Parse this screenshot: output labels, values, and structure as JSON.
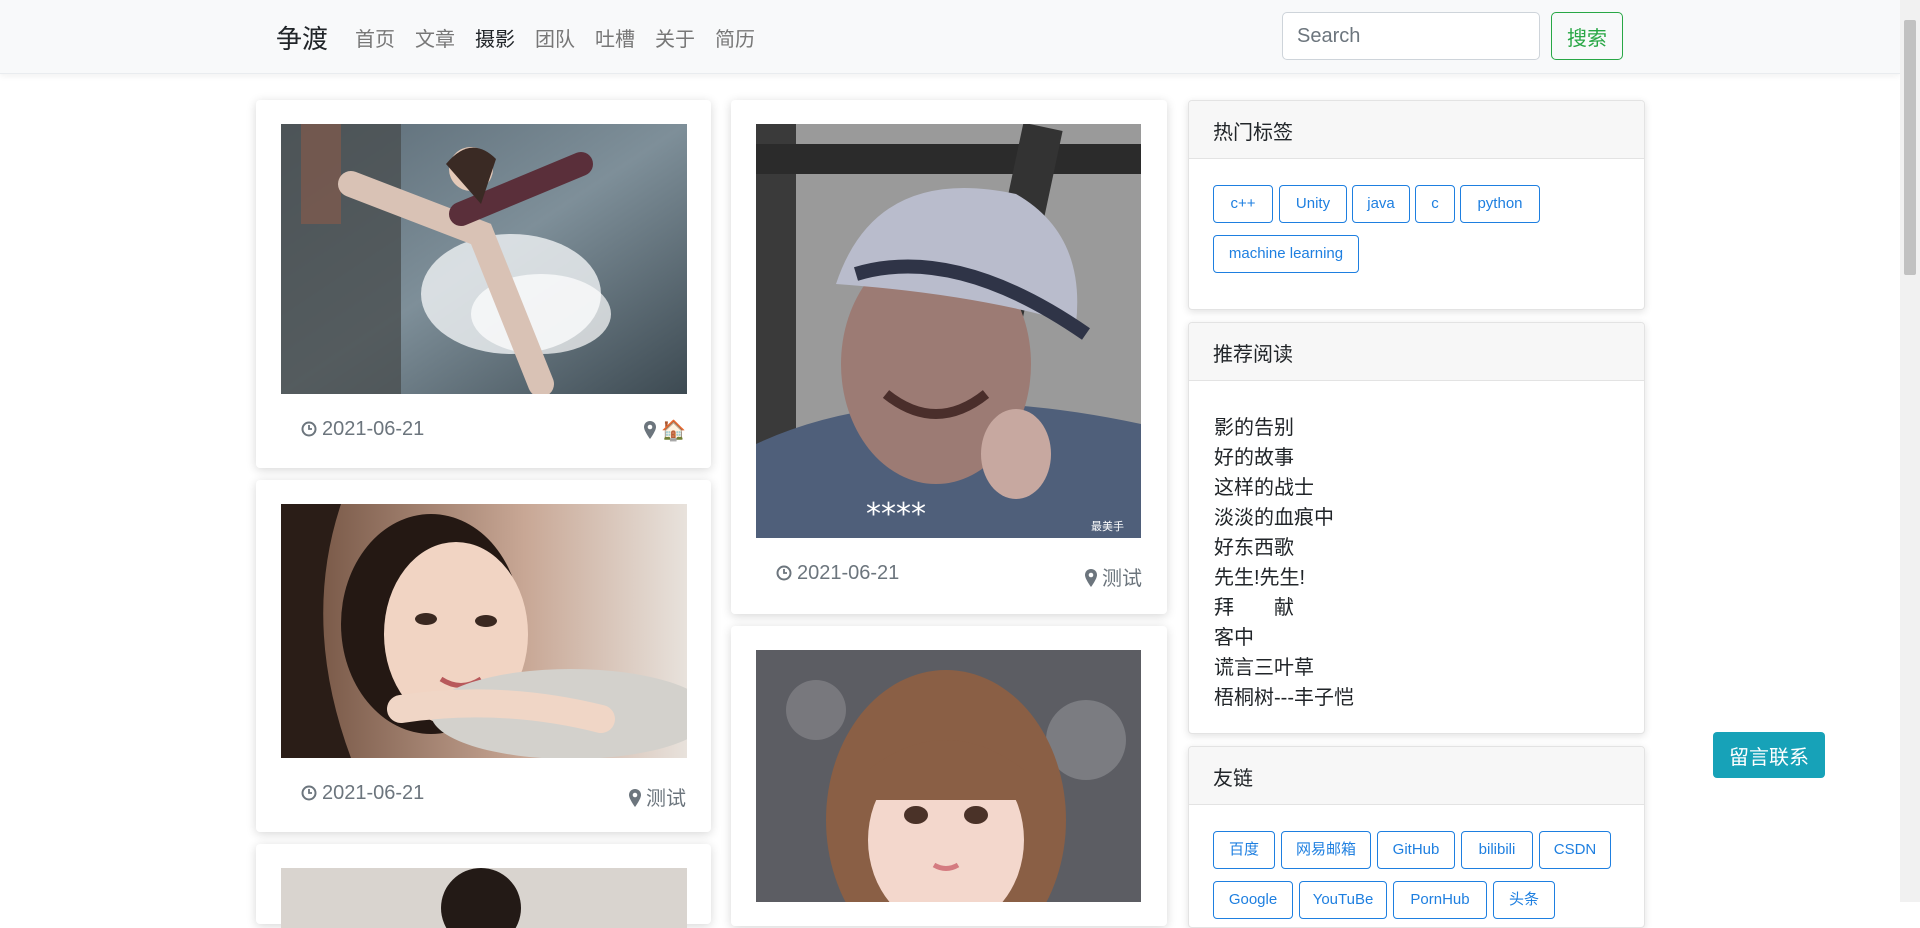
{
  "brand": "争渡",
  "nav": [
    "首页",
    "文章",
    "摄影",
    "团队",
    "吐槽",
    "关于",
    "简历"
  ],
  "nav_active": "摄影",
  "search": {
    "placeholder": "Search",
    "value": "",
    "button": "搜索"
  },
  "photos": [
    {
      "date": "2021-06-21",
      "location": "🏠"
    },
    {
      "date": "2021-06-21",
      "location": "测试"
    },
    {
      "date": "2021-06-21",
      "location": "测试"
    }
  ],
  "photo_icons": {
    "date": "clock-icon",
    "location": "map-marker-icon"
  },
  "watermark": "最美手",
  "sidebar": {
    "hot_tags": {
      "title": "热门标签",
      "tags": [
        "c++",
        "Unity",
        "java",
        "c",
        "python",
        "machine learning"
      ]
    },
    "recommended": {
      "title": "推荐阅读",
      "items": [
        "影的告别",
        "好的故事",
        "这样的战士",
        "淡淡的血痕中",
        "好东西歌",
        "先生!先生!",
        "拜　　献",
        "客中",
        "谎言三叶草",
        "梧桐树---丰子恺"
      ]
    },
    "links": {
      "title": "友链",
      "items": [
        "百度",
        "网易邮箱",
        "GitHub",
        "bilibili",
        "CSDN",
        "Google",
        "YouTuBe",
        "PornHub",
        "头条"
      ]
    }
  },
  "contact_button": "留言联系",
  "colors": {
    "accent": "#1e7fe0",
    "search": "#28a745",
    "contact": "#17a2b8",
    "navbar": "#f8f9fa"
  }
}
